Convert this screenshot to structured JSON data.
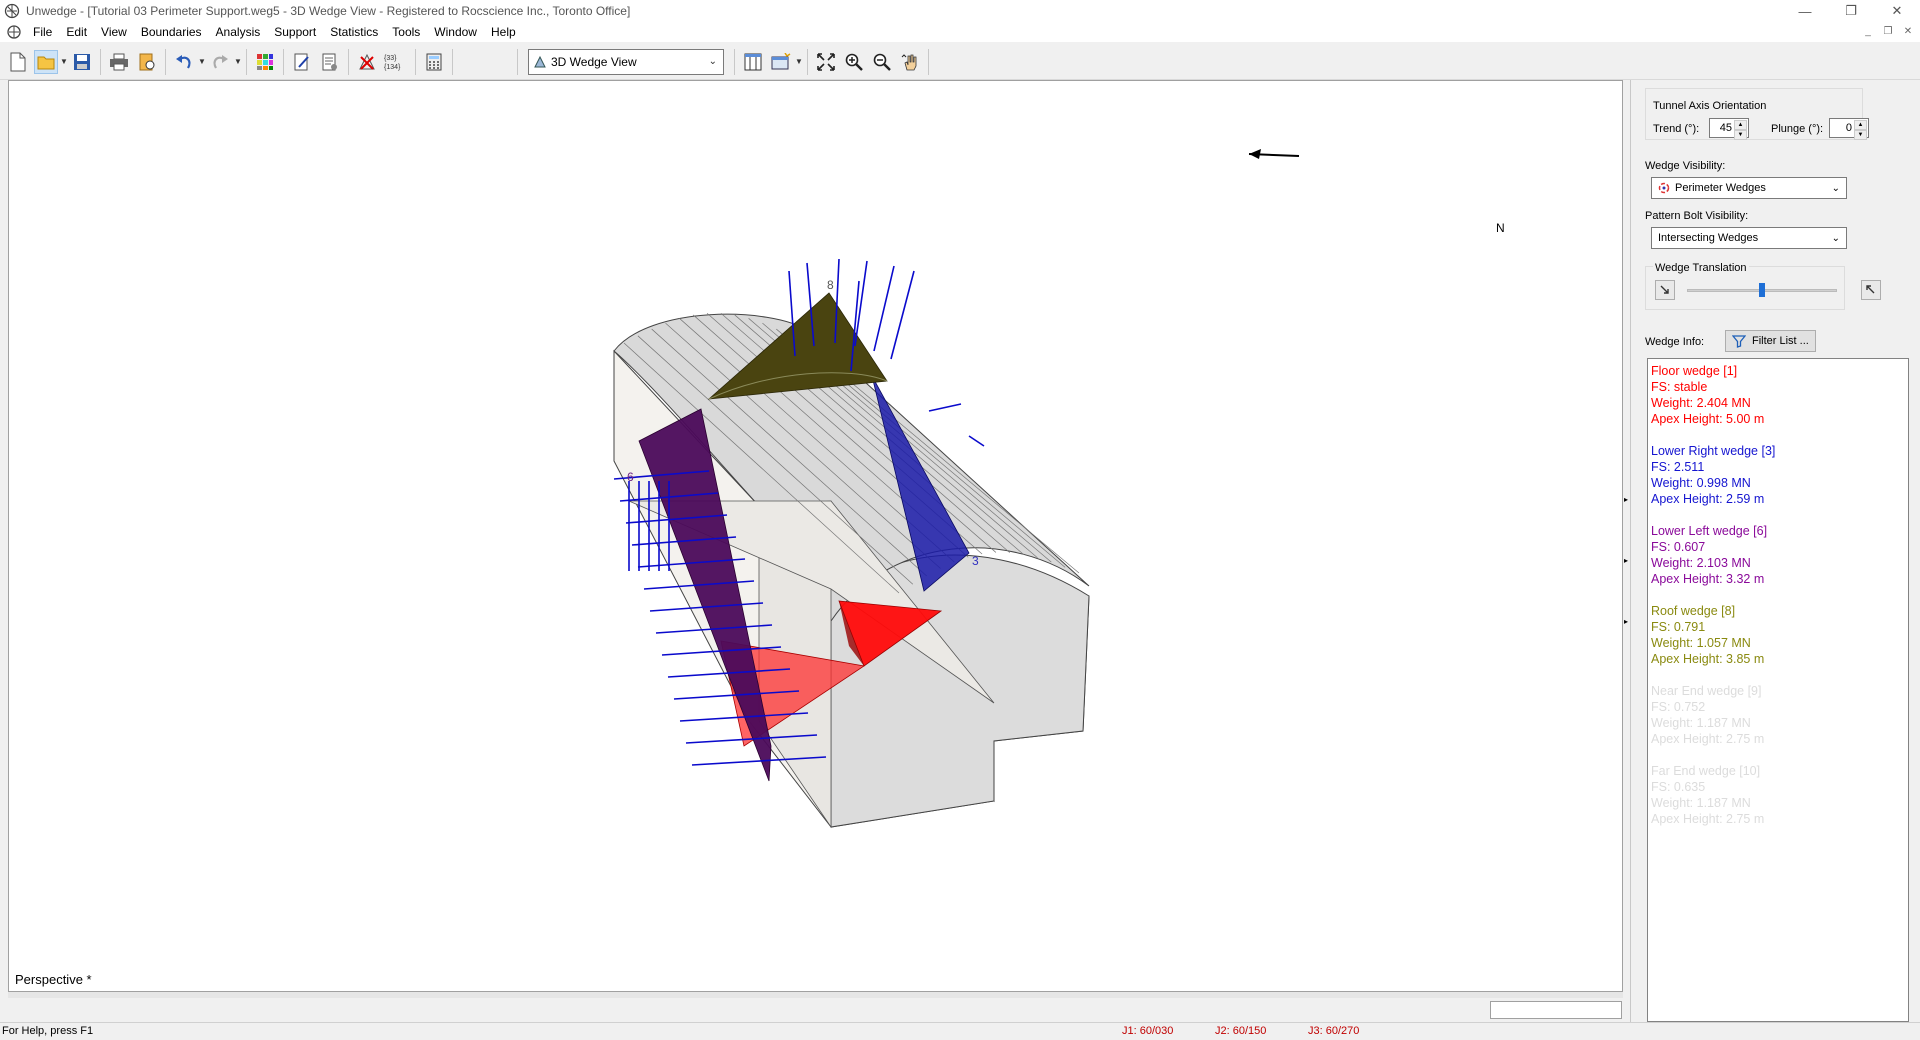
{
  "window": {
    "title": "Unwedge - [Tutorial 03 Perimeter Support.weg5 - 3D Wedge View - Registered to Rocscience Inc., Toronto Office]",
    "controls": [
      "—",
      "❐",
      "✕"
    ],
    "mdi_controls": [
      "_",
      "❐",
      "✕"
    ]
  },
  "menu": [
    "File",
    "Edit",
    "View",
    "Boundaries",
    "Analysis",
    "Support",
    "Statistics",
    "Tools",
    "Window",
    "Help"
  ],
  "toolbar": {
    "view_select": "3D Wedge View",
    "legend_icon_text": "{33}\n{134}"
  },
  "viewport": {
    "perspective_label": "Perspective *",
    "north_label": "N",
    "wedge_labels": {
      "roof": "8",
      "lower_left": "6",
      "lower_right": "3"
    },
    "colors": {
      "roof": "#4a4410",
      "lower_left": "#4b0a5a",
      "lower_right": "#1a1aa8",
      "floor": "#ff1a1a",
      "bolts": "#0a0acc",
      "tunnel": "#d8d8d8"
    }
  },
  "panel": {
    "tunnel_axis": {
      "title": "Tunnel Axis Orientation",
      "trend_label": "Trend (°):",
      "trend_value": "45",
      "plunge_label": "Plunge (°):",
      "plunge_value": "0"
    },
    "wedge_visibility": {
      "label": "Wedge Visibility:",
      "value": "Perimeter Wedges"
    },
    "bolt_visibility": {
      "label": "Pattern Bolt Visibility:",
      "value": "Intersecting Wedges"
    },
    "translation": {
      "title": "Wedge Translation",
      "level": 0.5
    },
    "wedge_info": {
      "label": "Wedge Info:",
      "filter_button": "Filter List ..."
    },
    "wedges": [
      {
        "lines": [
          "Floor wedge [1]",
          "FS: stable",
          "Weight: 2.404 MN",
          "Apex Height: 5.00 m"
        ],
        "color": "#ff0000"
      },
      {
        "lines": [
          "Lower Right wedge [3]",
          "FS: 2.511",
          "Weight: 0.998 MN",
          "Apex Height: 2.59 m"
        ],
        "color": "#1515d0"
      },
      {
        "lines": [
          "Lower Left wedge [6]",
          "FS: 0.607",
          "Weight: 2.103 MN",
          "Apex Height: 3.32 m"
        ],
        "color": "#8a0a9a"
      },
      {
        "lines": [
          "Roof wedge [8]",
          "FS: 0.791",
          "Weight: 1.057 MN",
          "Apex Height: 3.85 m"
        ],
        "color": "#8a8a10"
      },
      {
        "lines": [
          "Near End wedge [9]",
          "FS: 0.752",
          "Weight: 1.187 MN",
          "Apex Height: 2.75 m"
        ],
        "color": "#dcdcdc"
      },
      {
        "lines": [
          "Far End wedge [10]",
          "FS: 0.635",
          "Weight: 1.187 MN",
          "Apex Height: 2.75 m"
        ],
        "color": "#dcdcdc"
      }
    ]
  },
  "status": {
    "help": "For Help, press F1",
    "j1": "J1: 60/030",
    "j2": "J2: 60/150",
    "j3": "J3: 60/270"
  }
}
